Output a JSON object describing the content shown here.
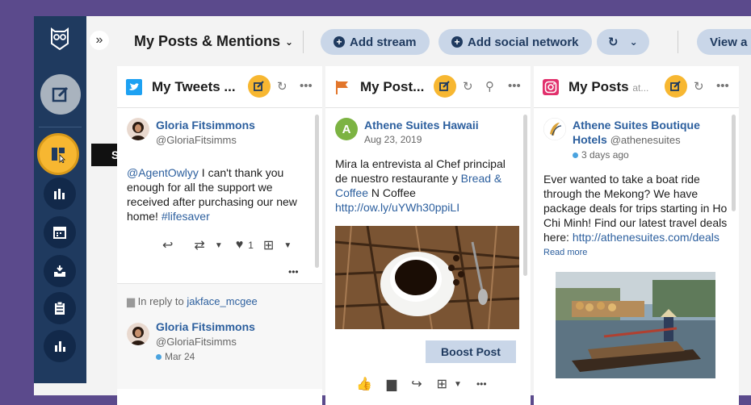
{
  "header": {
    "title": "My Posts & Mentions",
    "add_stream": "Add stream",
    "add_social": "Add social network",
    "view_all": "View a"
  },
  "nav": {
    "tooltip": "Streams"
  },
  "columns": [
    {
      "title": "My Tweets ...",
      "network": "twitter",
      "post": {
        "name": "Gloria Fitsimmons",
        "handle": "@GloriaFitsimms",
        "mention": "@AgentOwlyy",
        "text": " I can't thank you enough for all the support we received after purchasing our new home! ",
        "hashtag": "#lifesaver",
        "like_count": "1"
      },
      "reply": {
        "label": "In reply to",
        "user": "jakface_mcgee",
        "name": "Gloria Fitsimmons",
        "handle": "@GloriaFitsimms",
        "date": "Mar 24"
      }
    },
    {
      "title": "My Post...",
      "network": "facebook",
      "post": {
        "avatar_letter": "A",
        "name": "Athene Suites Hawaii",
        "date": "Aug 23, 2019",
        "text": "Mira la entrevista al Chef principal de nuestro restaurante y ",
        "link1": "Bread & Coffee",
        "text2": " N Coffee ",
        "link2": "http://ow.ly/uYWh30ppiLI",
        "boost": "Boost Post"
      }
    },
    {
      "title": "My Posts",
      "title_suffix": "at...",
      "network": "instagram",
      "post": {
        "name": "Athene Suites Boutique Hotels",
        "handle": "@athenesuites",
        "date": "3 days ago",
        "text": "Ever wanted to take a boat ride through the Mekong? We have package deals for trips starting in Ho Chi Minh! Find our latest travel deals here: ",
        "link": "http://athenesuites.com/deals",
        "read_more": "Read more"
      }
    }
  ]
}
